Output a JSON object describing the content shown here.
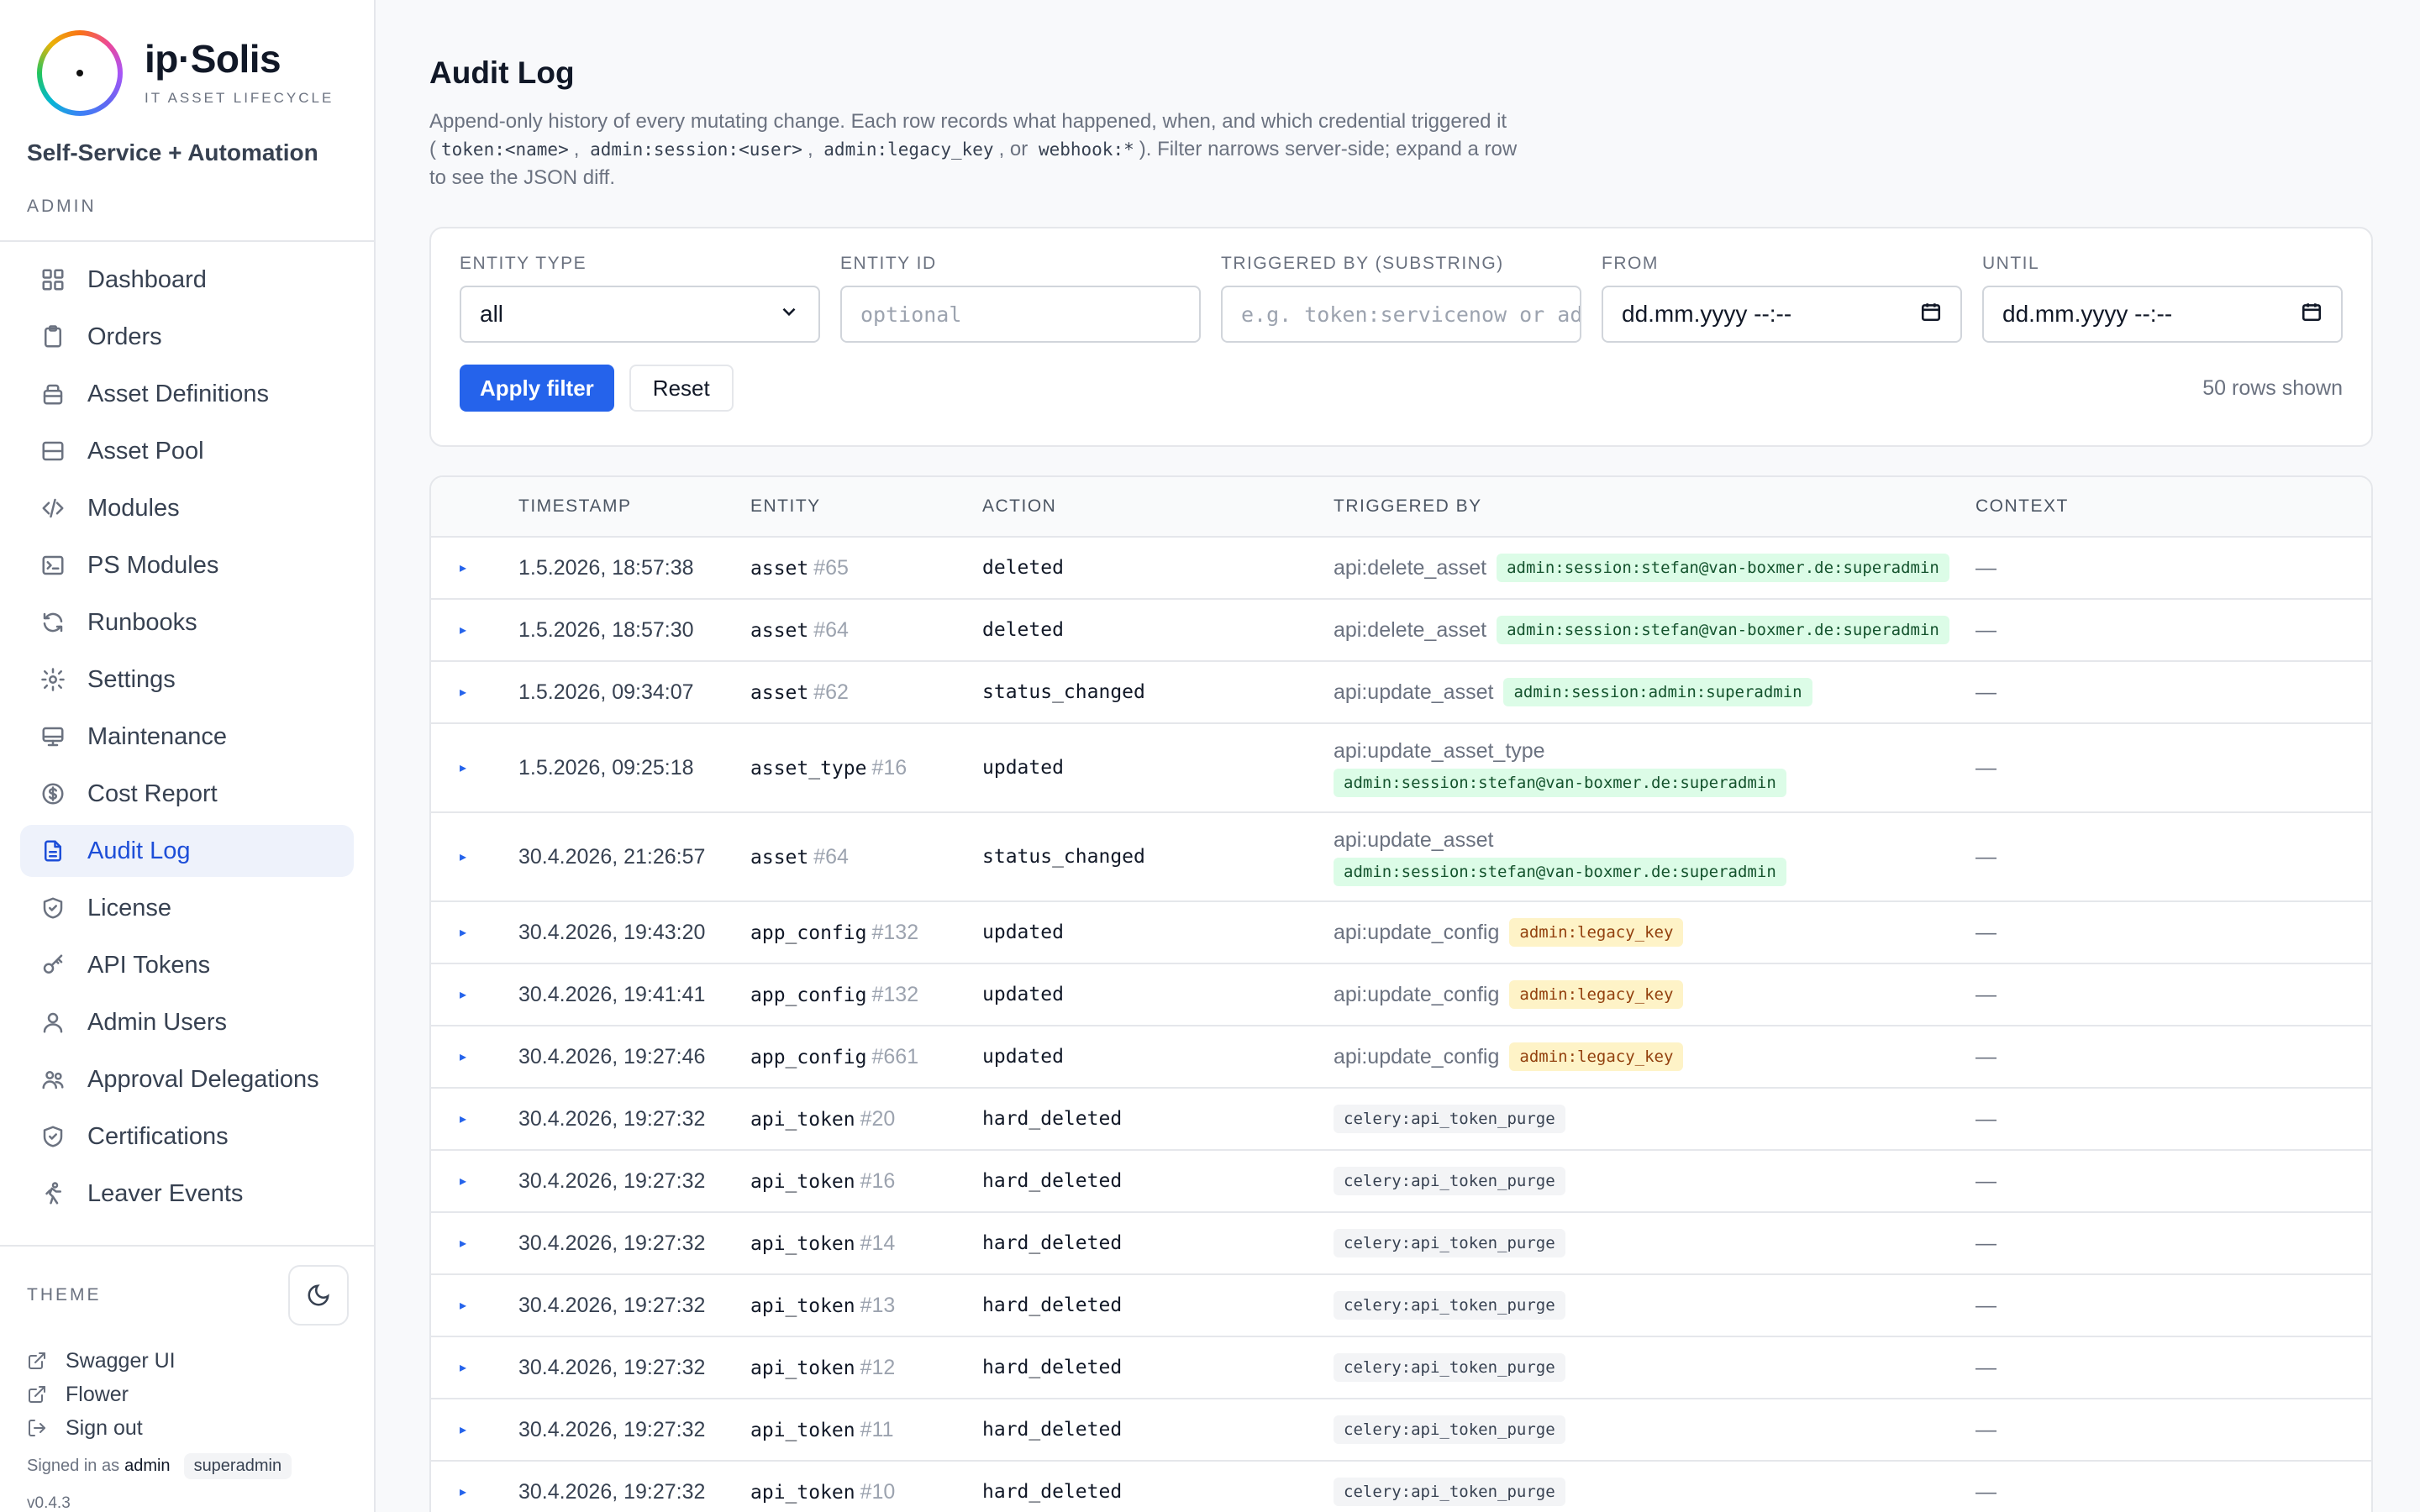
{
  "brand": {
    "name": "ip·Solis",
    "tagline": "IT ASSET LIFECYCLE",
    "subtitle": "Self-Service + Automation",
    "role": "ADMIN"
  },
  "nav": [
    {
      "label": "Dashboard",
      "icon": "dashboard-icon"
    },
    {
      "label": "Orders",
      "icon": "clipboard-icon"
    },
    {
      "label": "Asset Definitions",
      "icon": "layers-icon"
    },
    {
      "label": "Asset Pool",
      "icon": "server-icon"
    },
    {
      "label": "Modules",
      "icon": "code-icon"
    },
    {
      "label": "PS Modules",
      "icon": "terminal-icon"
    },
    {
      "label": "Runbooks",
      "icon": "refresh-icon"
    },
    {
      "label": "Settings",
      "icon": "gear-icon"
    },
    {
      "label": "Maintenance",
      "icon": "monitor-icon"
    },
    {
      "label": "Cost Report",
      "icon": "dollar-icon"
    },
    {
      "label": "Audit Log",
      "icon": "document-icon",
      "active": true
    },
    {
      "label": "License",
      "icon": "shield-icon"
    },
    {
      "label": "API Tokens",
      "icon": "key-icon"
    },
    {
      "label": "Admin Users",
      "icon": "user-icon"
    },
    {
      "label": "Approval Delegations",
      "icon": "users-icon"
    },
    {
      "label": "Certifications",
      "icon": "shield-check-icon"
    },
    {
      "label": "Leaver Events",
      "icon": "exit-icon"
    }
  ],
  "sidebar_bottom": {
    "theme_label": "THEME",
    "links": [
      {
        "label": "Swagger UI",
        "icon": "external-link-icon"
      },
      {
        "label": "Flower",
        "icon": "external-link-icon"
      },
      {
        "label": "Sign out",
        "icon": "sign-out-icon"
      }
    ],
    "signed_in_prefix": "Signed in as",
    "signed_in_user": "admin",
    "signed_in_role": "superadmin",
    "version": "v0.4.3"
  },
  "page": {
    "title": "Audit Log",
    "desc_1": "Append-only history of every mutating change. Each row records what happened, when, and which credential triggered it (",
    "desc_code_1": "token:<name>",
    "desc_sep_1": ",",
    "desc_code_2": "admin:session:<user>",
    "desc_sep_2": ",",
    "desc_code_3": "admin:legacy_key",
    "desc_sep_3": ", or",
    "desc_code_4": "webhook:*",
    "desc_2": "). Filter narrows server-side; expand a row to see the JSON diff."
  },
  "filter": {
    "entity_type_label": "ENTITY TYPE",
    "entity_type_value": "all",
    "entity_id_label": "ENTITY ID",
    "entity_id_placeholder": "optional",
    "triggered_by_label": "TRIGGERED BY (SUBSTRING)",
    "triggered_by_placeholder": "e.g. token:servicenow or admin",
    "from_label": "FROM",
    "from_value": "dd.mm.yyyy --:--",
    "until_label": "UNTIL",
    "until_value": "dd.mm.yyyy --:--",
    "apply_label": "Apply filter",
    "reset_label": "Reset",
    "rows_shown": "50 rows shown"
  },
  "table": {
    "headers": [
      "TIMESTAMP",
      "ENTITY",
      "ACTION",
      "TRIGGERED BY",
      "CONTEXT"
    ],
    "rows": [
      {
        "ts": "1.5.2026, 18:57:38",
        "entity": "asset",
        "id": "#65",
        "action": "deleted",
        "src": "api:delete_asset",
        "badge": "admin:session:stefan@van-boxmer.de:superadmin",
        "badge_color": "green",
        "stack": false,
        "ctx": "—"
      },
      {
        "ts": "1.5.2026, 18:57:30",
        "entity": "asset",
        "id": "#64",
        "action": "deleted",
        "src": "api:delete_asset",
        "badge": "admin:session:stefan@van-boxmer.de:superadmin",
        "badge_color": "green",
        "stack": false,
        "ctx": "—"
      },
      {
        "ts": "1.5.2026, 09:34:07",
        "entity": "asset",
        "id": "#62",
        "action": "status_changed",
        "src": "api:update_asset",
        "badge": "admin:session:admin:superadmin",
        "badge_color": "green",
        "stack": false,
        "ctx": "—"
      },
      {
        "ts": "1.5.2026, 09:25:18",
        "entity": "asset_type",
        "id": "#16",
        "action": "updated",
        "src": "api:update_asset_type",
        "badge": "admin:session:stefan@van-boxmer.de:superadmin",
        "badge_color": "green",
        "stack": true,
        "ctx": "—"
      },
      {
        "ts": "30.4.2026, 21:26:57",
        "entity": "asset",
        "id": "#64",
        "action": "status_changed",
        "src": "api:update_asset",
        "badge": "admin:session:stefan@van-boxmer.de:superadmin",
        "badge_color": "green",
        "stack": true,
        "ctx": "—"
      },
      {
        "ts": "30.4.2026, 19:43:20",
        "entity": "app_config",
        "id": "#132",
        "action": "updated",
        "src": "api:update_config",
        "badge": "admin:legacy_key",
        "badge_color": "yellow",
        "stack": false,
        "ctx": "—"
      },
      {
        "ts": "30.4.2026, 19:41:41",
        "entity": "app_config",
        "id": "#132",
        "action": "updated",
        "src": "api:update_config",
        "badge": "admin:legacy_key",
        "badge_color": "yellow",
        "stack": false,
        "ctx": "—"
      },
      {
        "ts": "30.4.2026, 19:27:46",
        "entity": "app_config",
        "id": "#661",
        "action": "updated",
        "src": "api:update_config",
        "badge": "admin:legacy_key",
        "badge_color": "yellow",
        "stack": false,
        "ctx": "—"
      },
      {
        "ts": "30.4.2026, 19:27:32",
        "entity": "api_token",
        "id": "#20",
        "action": "hard_deleted",
        "src": "",
        "badge": "celery:api_token_purge",
        "badge_color": "gray",
        "stack": false,
        "ctx": "—"
      },
      {
        "ts": "30.4.2026, 19:27:32",
        "entity": "api_token",
        "id": "#16",
        "action": "hard_deleted",
        "src": "",
        "badge": "celery:api_token_purge",
        "badge_color": "gray",
        "stack": false,
        "ctx": "—"
      },
      {
        "ts": "30.4.2026, 19:27:32",
        "entity": "api_token",
        "id": "#14",
        "action": "hard_deleted",
        "src": "",
        "badge": "celery:api_token_purge",
        "badge_color": "gray",
        "stack": false,
        "ctx": "—"
      },
      {
        "ts": "30.4.2026, 19:27:32",
        "entity": "api_token",
        "id": "#13",
        "action": "hard_deleted",
        "src": "",
        "badge": "celery:api_token_purge",
        "badge_color": "gray",
        "stack": false,
        "ctx": "—"
      },
      {
        "ts": "30.4.2026, 19:27:32",
        "entity": "api_token",
        "id": "#12",
        "action": "hard_deleted",
        "src": "",
        "badge": "celery:api_token_purge",
        "badge_color": "gray",
        "stack": false,
        "ctx": "—"
      },
      {
        "ts": "30.4.2026, 19:27:32",
        "entity": "api_token",
        "id": "#11",
        "action": "hard_deleted",
        "src": "",
        "badge": "celery:api_token_purge",
        "badge_color": "gray",
        "stack": false,
        "ctx": "—"
      },
      {
        "ts": "30.4.2026, 19:27:32",
        "entity": "api_token",
        "id": "#10",
        "action": "hard_deleted",
        "src": "",
        "badge": "celery:api_token_purge",
        "badge_color": "gray",
        "stack": false,
        "ctx": "—"
      }
    ]
  },
  "colors": {
    "accent": "#2563eb",
    "active_nav_bg": "#eef2fb",
    "badge_green": "#dcfce7",
    "badge_yellow": "#fef3c7"
  }
}
